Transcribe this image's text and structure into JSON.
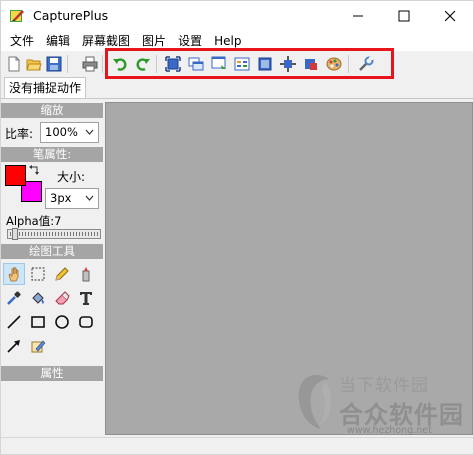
{
  "window": {
    "title": "CapturePlus",
    "icon": "paint-brush-app-icon",
    "controls": [
      "minimize-icon",
      "maximize-icon",
      "close-icon"
    ]
  },
  "menu": {
    "items": [
      "文件",
      "编辑",
      "屏幕截图",
      "图片",
      "设置",
      "Help"
    ]
  },
  "toolbar": {
    "file_tools": [
      "new-file-icon",
      "open-folder-icon",
      "save-icon",
      "print-icon"
    ],
    "highlighted_tools": [
      "undo-icon",
      "redo-icon",
      "capture-fullscreen-icon",
      "capture-window-icon",
      "capture-scroll-icon",
      "capture-menu-icon",
      "capture-active-icon",
      "capture-region-icon",
      "capture-objects-icon",
      "color-picker-palette-icon",
      "settings-wrench-icon"
    ],
    "highlight_color": "#e8141c"
  },
  "tabs": {
    "active": "没有捕捉动作"
  },
  "panel": {
    "zoom_header": "缩放",
    "zoom_label": "比率:",
    "zoom_value": "100%",
    "pen_header": "笔属性:",
    "size_label": "大小:",
    "size_value": "3px",
    "alpha_label": "Alpha值:7",
    "primary_color": "#ff0000",
    "secondary_color": "#ff00ff",
    "tools_header": "绘图工具",
    "tools": [
      "hand-icon",
      "select-rect-icon",
      "pencil-icon",
      "highlighter-icon",
      "eyedropper-icon",
      "fill-bucket-icon",
      "eraser-icon",
      "text-icon",
      "line-icon",
      "rectangle-icon",
      "ellipse-icon",
      "rounded-rect-icon",
      "arrow-icon",
      "stamp-icon"
    ],
    "props_header": "属性"
  },
  "watermark": {
    "small": "当下软件园",
    "big": "合众软件园",
    "url": "www.hezhong.net"
  }
}
